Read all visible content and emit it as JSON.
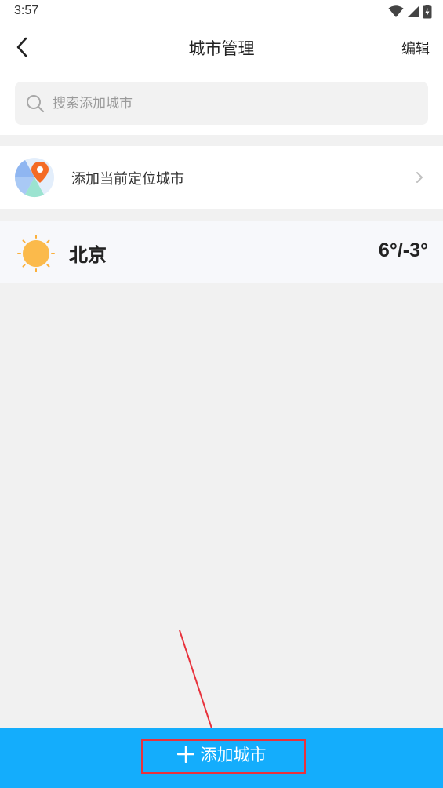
{
  "status_bar": {
    "time": "3:57",
    "icons": [
      "wifi-icon",
      "signal-icon",
      "battery-charging-icon"
    ]
  },
  "header": {
    "title": "城市管理",
    "back_icon": "chevron-left-icon",
    "edit_label": "编辑"
  },
  "search": {
    "placeholder": "搜索添加城市",
    "value": "",
    "icon": "search-icon"
  },
  "locate": {
    "label": "添加当前定位城市",
    "icon": "map-pin-icon",
    "chevron_icon": "chevron-right-icon"
  },
  "cities": [
    {
      "name": "北京",
      "temperature": "6°/-3°",
      "weather_icon": "sun-icon"
    }
  ],
  "bottom_bar": {
    "add_label": "添加城市",
    "icon": "plus-icon"
  },
  "colors": {
    "accent_blue": "#14adfc",
    "highlight_red": "#e8323c",
    "background": "#f1f1f1",
    "sun_orange": "#fbb03b",
    "pin_orange": "#f46b25"
  }
}
